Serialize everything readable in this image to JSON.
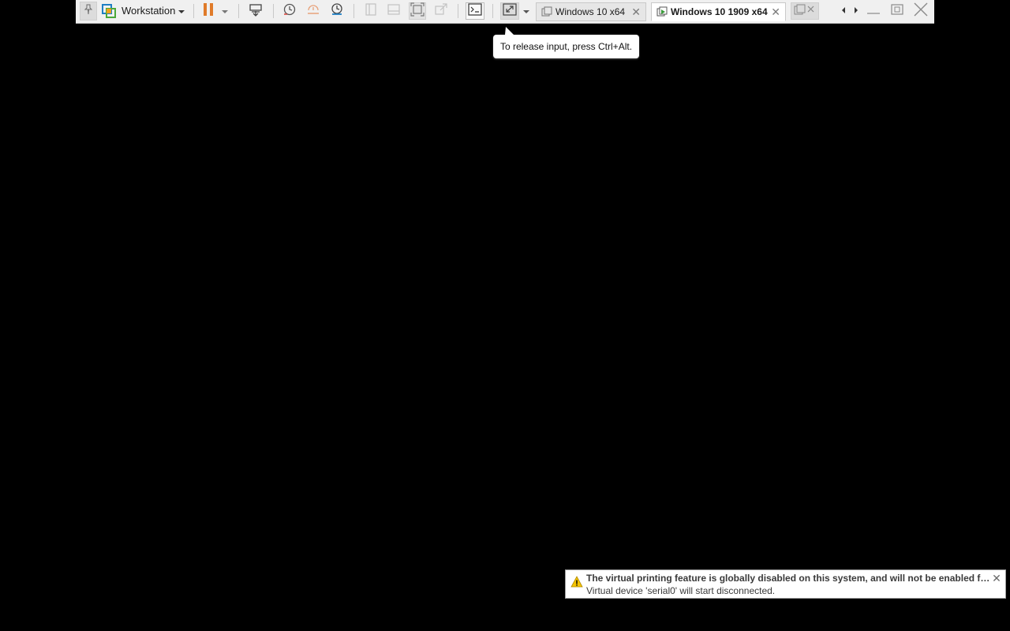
{
  "toolbar": {
    "product_label": "Workstation",
    "icons": [
      "pin-icon",
      "workstation-logo-icon",
      "chevron-down-icon",
      "pause-icon",
      "send-ctrl-alt-del-icon",
      "snapshot-take-icon",
      "snapshot-revert-icon",
      "snapshot-manager-icon",
      "library-view-icon",
      "thumbnail-bar-icon",
      "fit-guest-icon",
      "unity-icon",
      "console-view-icon",
      "full-screen-icon",
      "tab-list-icon",
      "arrow-left-icon",
      "arrow-right-icon",
      "minimize-icon",
      "restore-icon",
      "close-icon"
    ],
    "pause_color": "#e07b2a"
  },
  "tabs": [
    {
      "label": "Windows 10 x64",
      "active": false
    },
    {
      "label": "Windows 10 1909 x64",
      "active": true
    }
  ],
  "tooltip": {
    "text": "To release input, press Ctrl+Alt."
  },
  "notification": {
    "title": "The virtual printing feature is globally disabled on this system, and will not be enabled for t...",
    "message": "Virtual device 'serial0' will start disconnected.",
    "warning_color": "#f5c400"
  }
}
